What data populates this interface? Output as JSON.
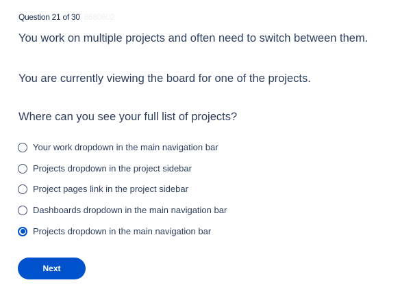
{
  "counter": "Question 21 of 30",
  "code": "8680602",
  "question": [
    "You work on multiple projects and often need to switch between them.",
    "You are currently viewing the board for one of the projects.",
    "Where can you see your full list of projects?"
  ],
  "options": [
    "Your work dropdown in the main navigation bar",
    "Projects dropdown in the project sidebar",
    "Project pages link in the project sidebar",
    "Dashboards dropdown in the main navigation bar",
    "Projects dropdown in the main navigation bar"
  ],
  "selected_index": 4,
  "next_label": "Next"
}
